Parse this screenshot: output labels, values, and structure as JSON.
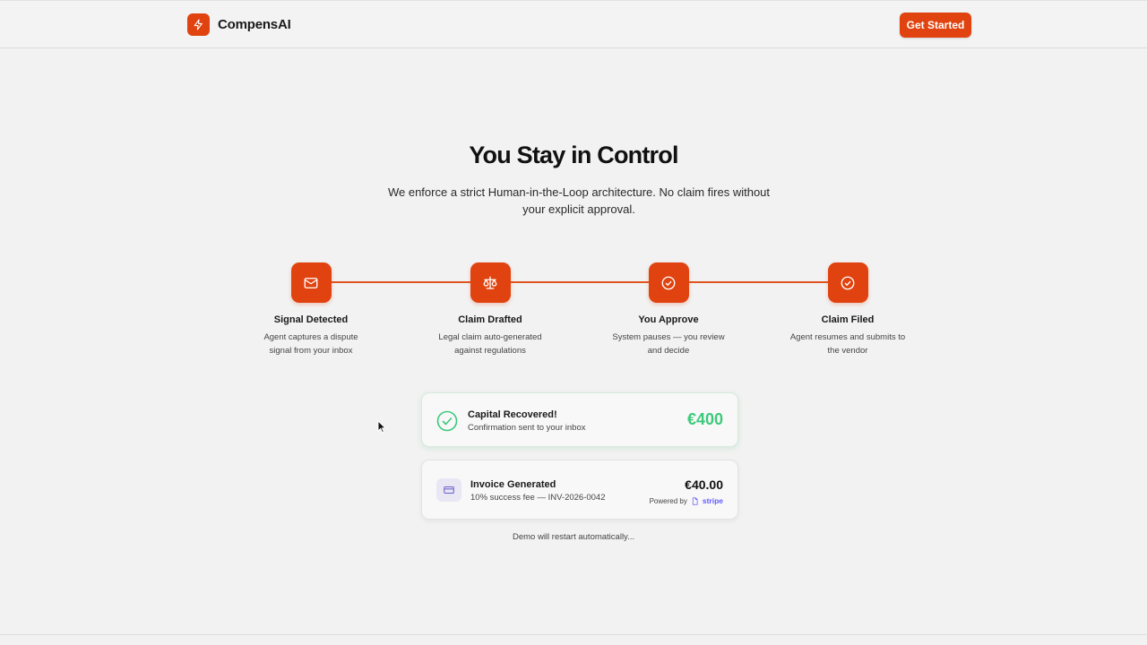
{
  "header": {
    "brand_name": "CompensAI",
    "cta_label": "Get Started"
  },
  "hero": {
    "title": "You Stay in Control",
    "subtitle": "We enforce a strict Human-in-the-Loop architecture. No claim fires without your explicit approval."
  },
  "steps": [
    {
      "icon": "mail-icon",
      "title": "Signal Detected",
      "description": "Agent captures a dispute signal from your inbox"
    },
    {
      "icon": "scale-icon",
      "title": "Claim Drafted",
      "description": "Legal claim auto-generated against regulations"
    },
    {
      "icon": "check-circle-icon",
      "title": "You Approve",
      "description": "System pauses — you review and decide"
    },
    {
      "icon": "check-circle-icon",
      "title": "Claim Filed",
      "description": "Agent resumes and submits to the vendor"
    }
  ],
  "recovered_card": {
    "title": "Capital Recovered!",
    "subtitle": "Confirmation sent to your inbox",
    "amount": "€400"
  },
  "invoice_card": {
    "title": "Invoice Generated",
    "subtitle": "10% success fee — INV-2026-0042",
    "amount": "€40.00",
    "powered_by": "Powered by",
    "provider": "stripe"
  },
  "footer_note": "Demo will restart automatically...",
  "colors": {
    "accent": "#e0430f",
    "success": "#3cc97b",
    "stripe": "#635bff",
    "background": "#f2f2f2"
  }
}
